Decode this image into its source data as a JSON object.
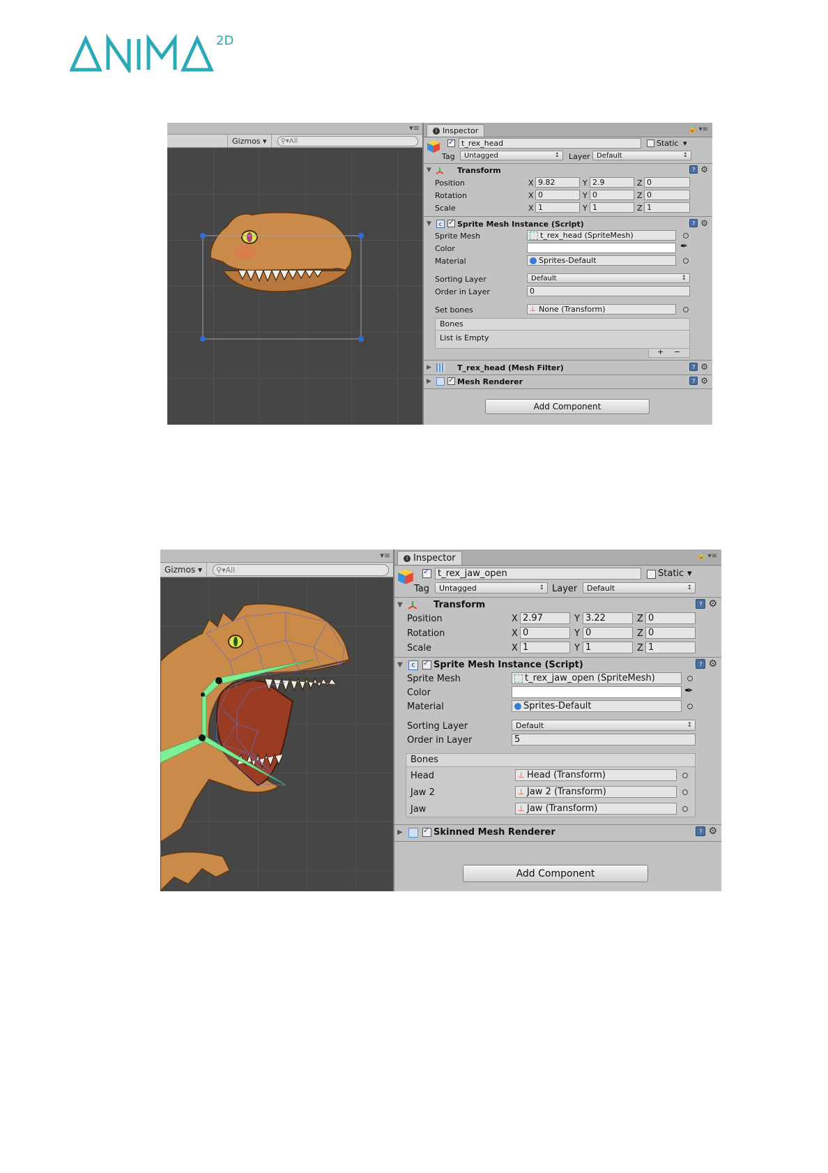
{
  "logo": {
    "word": "ANIMA",
    "sup": "2D",
    "color": "#2aaab6"
  },
  "screens": [
    {
      "scene": {
        "gizmos": "Gizmos",
        "search": "All"
      },
      "inspector": {
        "tab": "Inspector",
        "object_name": "t_rex_head",
        "static_label": "Static",
        "tag_label": "Tag",
        "tag_value": "Untagged",
        "layer_label": "Layer",
        "layer_value": "Default",
        "transform": {
          "title": "Transform",
          "position": {
            "label": "Position",
            "x": "9.82",
            "y": "2.9",
            "z": "0"
          },
          "rotation": {
            "label": "Rotation",
            "x": "0",
            "y": "0",
            "z": "0"
          },
          "scale": {
            "label": "Scale",
            "x": "1",
            "y": "1",
            "z": "1"
          }
        },
        "smi": {
          "title": "Sprite Mesh Instance (Script)",
          "sprite_mesh_label": "Sprite Mesh",
          "sprite_mesh_value": "t_rex_head (SpriteMesh)",
          "color_label": "Color",
          "material_label": "Material",
          "material_value": "Sprites-Default",
          "sorting_layer_label": "Sorting Layer",
          "sorting_layer_value": "Default",
          "order_label": "Order in Layer",
          "order_value": "0",
          "set_bones_label": "Set bones",
          "set_bones_value": "None (Transform)",
          "bones_header": "Bones",
          "bones_empty": "List is Empty",
          "plus": "+",
          "minus": "−"
        },
        "mesh_filter": "T_rex_head (Mesh Filter)",
        "mesh_renderer": "Mesh Renderer",
        "add_component": "Add Component"
      }
    },
    {
      "scene": {
        "gizmos": "Gizmos",
        "search": "All"
      },
      "inspector": {
        "tab": "Inspector",
        "object_name": "t_rex_jaw_open",
        "static_label": "Static",
        "tag_label": "Tag",
        "tag_value": "Untagged",
        "layer_label": "Layer",
        "layer_value": "Default",
        "transform": {
          "title": "Transform",
          "position": {
            "label": "Position",
            "x": "2.97",
            "y": "3.22",
            "z": "0"
          },
          "rotation": {
            "label": "Rotation",
            "x": "0",
            "y": "0",
            "z": "0"
          },
          "scale": {
            "label": "Scale",
            "x": "1",
            "y": "1",
            "z": "1"
          }
        },
        "smi": {
          "title": "Sprite Mesh Instance (Script)",
          "sprite_mesh_label": "Sprite Mesh",
          "sprite_mesh_value": "t_rex_jaw_open (SpriteMesh)",
          "color_label": "Color",
          "material_label": "Material",
          "material_value": "Sprites-Default",
          "sorting_layer_label": "Sorting Layer",
          "sorting_layer_value": "Default",
          "order_label": "Order in Layer",
          "order_value": "5",
          "bones_header": "Bones",
          "bones": [
            {
              "name": "Head",
              "value": "Head (Transform)"
            },
            {
              "name": "Jaw 2",
              "value": "Jaw 2 (Transform)"
            },
            {
              "name": "Jaw",
              "value": "Jaw (Transform)"
            }
          ]
        },
        "skinned_renderer": "Skinned Mesh Renderer",
        "add_component": "Add Component"
      }
    }
  ],
  "axis": {
    "x": "X",
    "y": "Y",
    "z": "Z"
  },
  "colors": {
    "bone": "#7cf59a",
    "handle": "#2f6fd6",
    "mesh": "#6a6fb8",
    "skin": "#c98a4a"
  }
}
